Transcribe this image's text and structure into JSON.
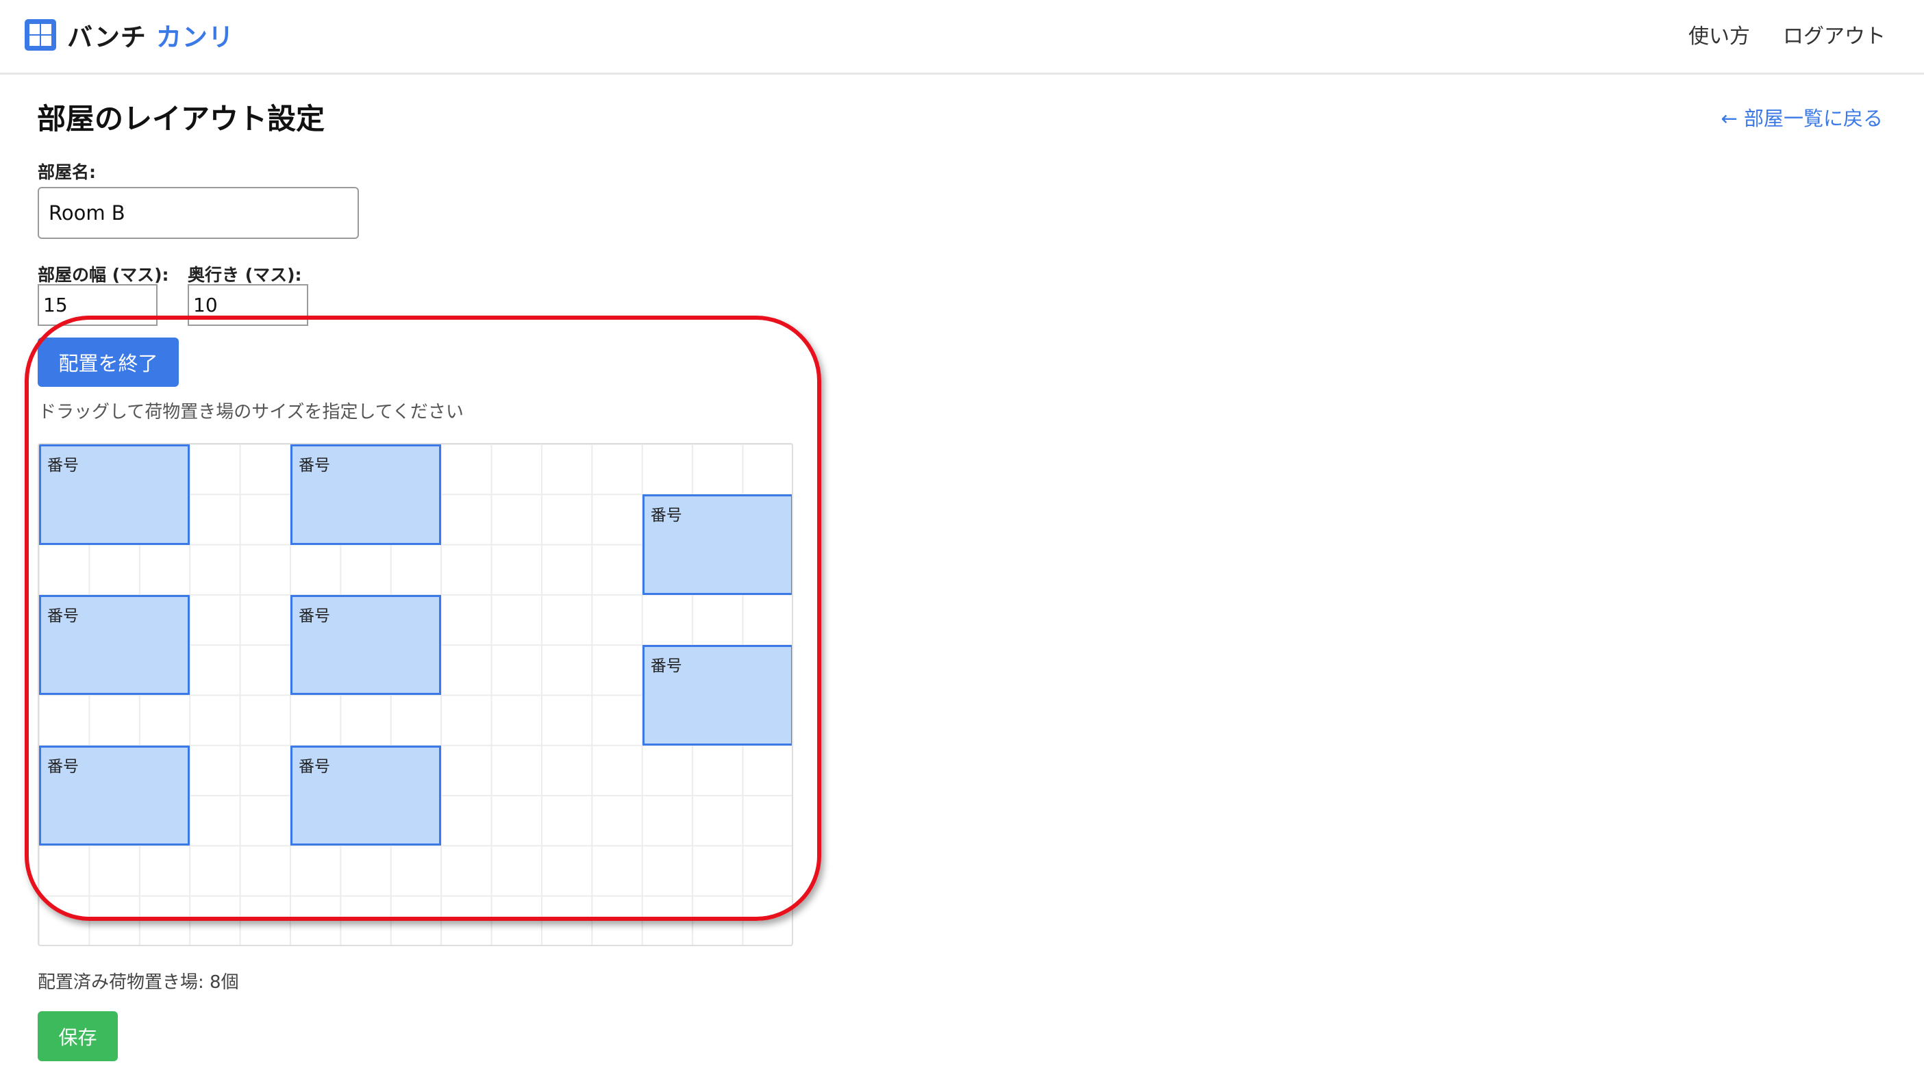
{
  "header": {
    "brand_primary": "バンチ",
    "brand_accent": "カンリ",
    "brand_icon": "grid-icon",
    "nav": {
      "help": "使い方",
      "logout": "ログアウト"
    }
  },
  "page": {
    "title": "部屋のレイアウト設定",
    "back_link": "← 部屋一覧に戻る"
  },
  "form": {
    "room_name_label": "部屋名:",
    "room_name_value": "Room B",
    "width_label": "部屋の幅 (マス):",
    "width_value": "15",
    "depth_label": "奥行き (マス):",
    "depth_value": "10",
    "finish_button": "配置を終了",
    "instruction": "ドラッグして荷物置き場のサイズを指定してください"
  },
  "grid": {
    "columns": 15,
    "rows": 10,
    "slots": [
      {
        "label": "番号",
        "col": 0,
        "row": 0,
        "w": 3,
        "h": 2
      },
      {
        "label": "番号",
        "col": 5,
        "row": 0,
        "w": 3,
        "h": 2
      },
      {
        "label": "番号",
        "col": 12,
        "row": 1,
        "w": 3,
        "h": 2
      },
      {
        "label": "番号",
        "col": 0,
        "row": 3,
        "w": 3,
        "h": 2
      },
      {
        "label": "番号",
        "col": 5,
        "row": 3,
        "w": 3,
        "h": 2
      },
      {
        "label": "番号",
        "col": 12,
        "row": 4,
        "w": 3,
        "h": 2
      },
      {
        "label": "番号",
        "col": 0,
        "row": 6,
        "w": 3,
        "h": 2
      },
      {
        "label": "番号",
        "col": 5,
        "row": 6,
        "w": 3,
        "h": 2
      }
    ]
  },
  "placed_count_text": "配置済み荷物置き場: 8個",
  "save_button": "保存",
  "colors": {
    "accent": "#3b7ae6",
    "slot_fill": "#bfd9fb",
    "save": "#3dbb5c",
    "highlight": "#e8101c"
  }
}
